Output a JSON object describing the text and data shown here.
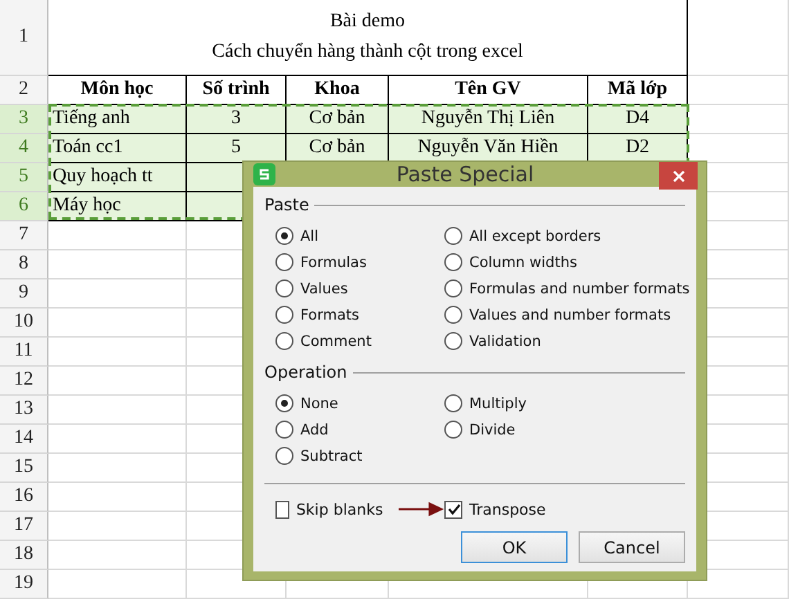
{
  "sheet": {
    "row_numbers": [
      {
        "label": "1",
        "selected": false
      },
      {
        "label": "2",
        "selected": false
      },
      {
        "label": "3",
        "selected": true
      },
      {
        "label": "4",
        "selected": true
      },
      {
        "label": "5",
        "selected": true
      },
      {
        "label": "6",
        "selected": true
      },
      {
        "label": "7",
        "selected": false
      },
      {
        "label": "8",
        "selected": false
      },
      {
        "label": "9",
        "selected": false
      },
      {
        "label": "10",
        "selected": false
      },
      {
        "label": "11",
        "selected": false
      },
      {
        "label": "12",
        "selected": false
      },
      {
        "label": "13",
        "selected": false
      },
      {
        "label": "14",
        "selected": false
      },
      {
        "label": "15",
        "selected": false
      },
      {
        "label": "16",
        "selected": false
      },
      {
        "label": "17",
        "selected": false
      },
      {
        "label": "18",
        "selected": false
      },
      {
        "label": "19",
        "selected": false
      }
    ],
    "title_lines": [
      "Bài demo",
      "Cách chuyển hàng thành cột trong excel"
    ],
    "header": [
      "Môn học",
      "Số trình",
      "Khoa",
      "Tên GV",
      "Mã lớp"
    ],
    "rows": [
      {
        "selected": true,
        "cells": [
          "Tiếng anh",
          "3",
          "Cơ bản",
          "Nguyễn Thị Liên",
          "D4"
        ]
      },
      {
        "selected": true,
        "cells": [
          "Toán cc1",
          "5",
          "Cơ bản",
          "Nguyễn Văn Hiền",
          "D2"
        ]
      },
      {
        "selected": true,
        "cells": [
          "Quy hoạch tt"
        ]
      },
      {
        "selected": true,
        "cells": [
          "Máy học"
        ]
      }
    ]
  },
  "dialog": {
    "title": "Paste Special",
    "paste": {
      "label": "Paste",
      "options": [
        {
          "label": "All",
          "selected": true
        },
        {
          "label": "Formulas",
          "selected": false
        },
        {
          "label": "Values",
          "selected": false
        },
        {
          "label": "Formats",
          "selected": false
        },
        {
          "label": "Comment",
          "selected": false
        },
        {
          "label": "All except borders",
          "selected": false
        },
        {
          "label": "Column widths",
          "selected": false
        },
        {
          "label": "Formulas and number formats",
          "selected": false
        },
        {
          "label": "Values and number formats",
          "selected": false
        },
        {
          "label": "Validation",
          "selected": false
        }
      ]
    },
    "operation": {
      "label": "Operation",
      "options": [
        {
          "label": "None",
          "selected": true
        },
        {
          "label": "Add",
          "selected": false
        },
        {
          "label": "Subtract",
          "selected": false
        },
        {
          "label": "Multiply",
          "selected": false
        },
        {
          "label": "Divide",
          "selected": false
        }
      ]
    },
    "checkboxes": [
      {
        "label": "Skip blanks",
        "checked": false
      },
      {
        "label": "Transpose",
        "checked": true
      }
    ],
    "buttons": [
      {
        "label": "OK",
        "default": true
      },
      {
        "label": "Cancel",
        "default": false
      }
    ]
  }
}
